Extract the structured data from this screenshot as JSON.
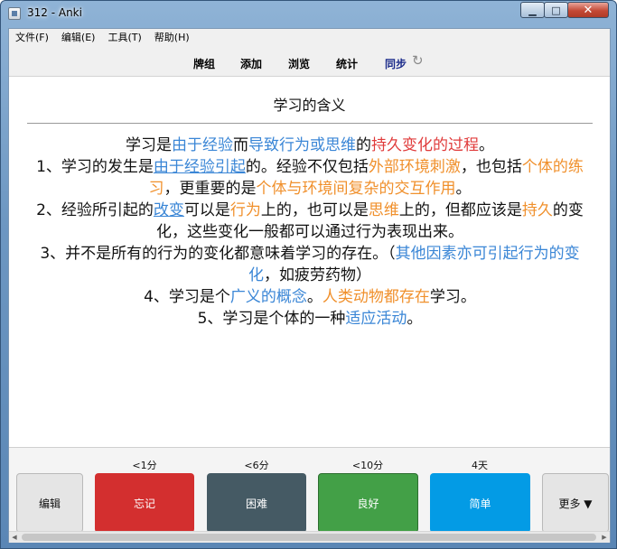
{
  "window": {
    "title": "312 - Anki",
    "min_label": "▁",
    "max_label": "□",
    "close_label": "✕"
  },
  "menu": [
    "文件(F)",
    "编辑(E)",
    "工具(T)",
    "帮助(H)"
  ],
  "toolbar": {
    "decks": "牌组",
    "add": "添加",
    "browse": "浏览",
    "stats": "统计",
    "sync": "同步"
  },
  "card": {
    "title": "学习的含义",
    "lines": [
      [
        {
          "t": "学习是",
          "c": ""
        },
        {
          "t": "由于经验",
          "c": "b"
        },
        {
          "t": "而",
          "c": ""
        },
        {
          "t": "导致行为或思维",
          "c": "b"
        },
        {
          "t": "的",
          "c": ""
        },
        {
          "t": "持久变化的过程",
          "c": "r"
        },
        {
          "t": "。",
          "c": ""
        }
      ],
      [
        {
          "t": "1、学习的发生是",
          "c": ""
        },
        {
          "t": "由于经验引起",
          "c": "u"
        },
        {
          "t": "的。经验不仅包括",
          "c": ""
        },
        {
          "t": "外部环境刺激",
          "c": "o"
        },
        {
          "t": "，也包括",
          "c": ""
        },
        {
          "t": "个体的练习",
          "c": "o"
        },
        {
          "t": "，更重要的是",
          "c": ""
        },
        {
          "t": "个体与环境间复杂的交互作用",
          "c": "o"
        },
        {
          "t": "。",
          "c": ""
        }
      ],
      [
        {
          "t": "2、经验所引起的",
          "c": ""
        },
        {
          "t": "改变",
          "c": "u"
        },
        {
          "t": "可以是",
          "c": ""
        },
        {
          "t": "行为",
          "c": "o"
        },
        {
          "t": "上的，也可以是",
          "c": ""
        },
        {
          "t": "思维",
          "c": "o"
        },
        {
          "t": "上的，但都应该是",
          "c": ""
        },
        {
          "t": "持久",
          "c": "o"
        },
        {
          "t": "的变化，这些变化一般都可以通过行为表现出来。",
          "c": ""
        }
      ],
      [
        {
          "t": "3、并不是所有的行为的变化都意味着学习的存在。（",
          "c": ""
        },
        {
          "t": "其他因素亦可引起行为的变化",
          "c": "b"
        },
        {
          "t": "，如疲劳药物）",
          "c": ""
        }
      ],
      [
        {
          "t": "4、学习是个",
          "c": ""
        },
        {
          "t": "广义的概念",
          "c": "b"
        },
        {
          "t": "。",
          "c": ""
        },
        {
          "t": "人类动物都存在",
          "c": "o"
        },
        {
          "t": "学习。",
          "c": ""
        }
      ],
      [
        {
          "t": "5、学习是个体的一种",
          "c": ""
        },
        {
          "t": "适应活动",
          "c": "b"
        },
        {
          "t": "。",
          "c": ""
        }
      ]
    ]
  },
  "answer": {
    "edit": "编辑",
    "more": "更多 ▼",
    "buttons": [
      {
        "label": "忘记",
        "interval": "<1分"
      },
      {
        "label": "困难",
        "interval": "<6分"
      },
      {
        "label": "良好",
        "interval": "<10分"
      },
      {
        "label": "简单",
        "interval": "4天"
      }
    ]
  },
  "colors": {
    "again": "#d32f2f",
    "hard": "#455a64",
    "good": "#43a047",
    "easy": "#039be5",
    "highlight_blue": "#3a86d6",
    "highlight_red": "#e03b3b",
    "highlight_orange": "#f0902c"
  },
  "icons": {
    "sync": "sync-icon"
  }
}
